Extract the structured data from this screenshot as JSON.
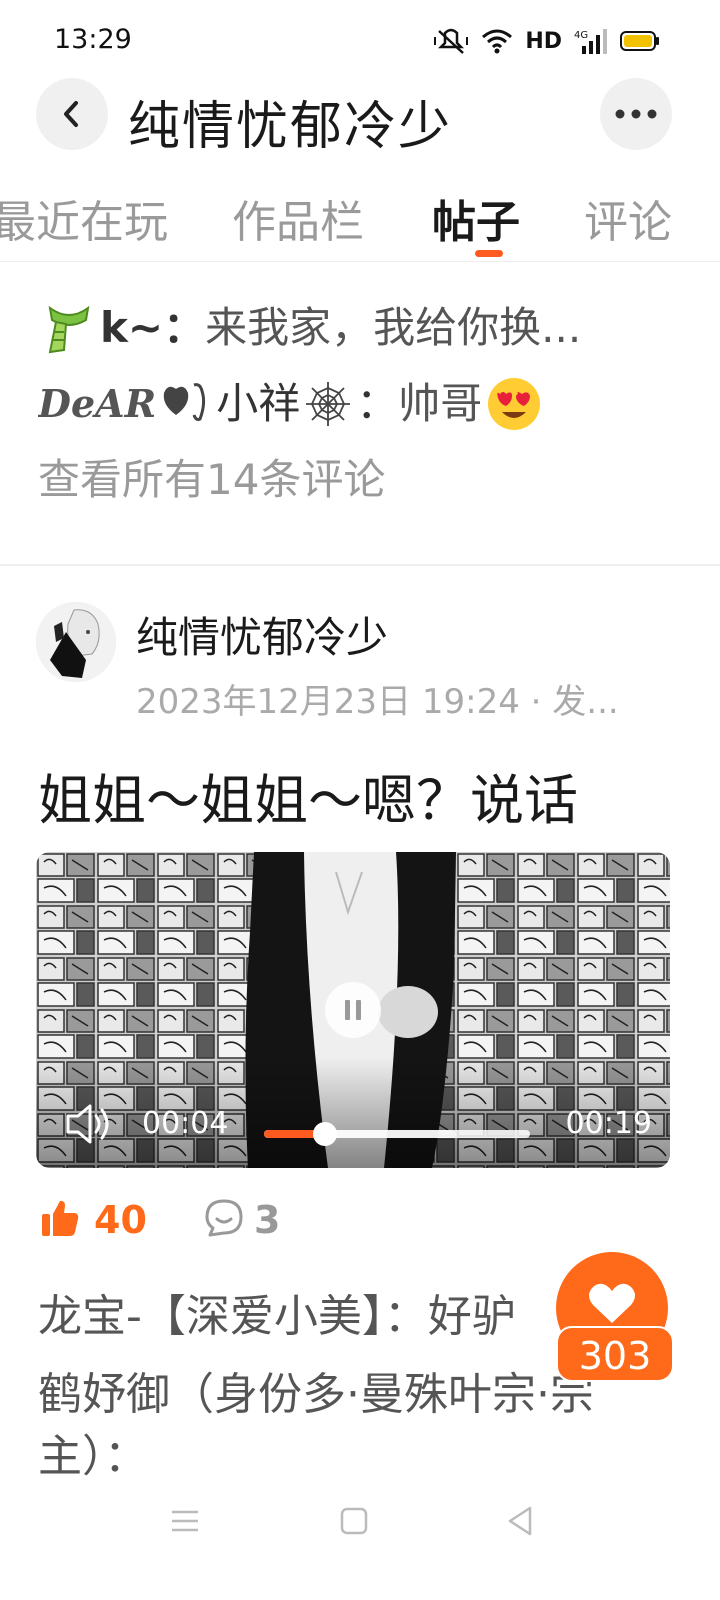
{
  "status_bar": {
    "time": "13:29",
    "network": "HD",
    "signal": "4G"
  },
  "header": {
    "title": "纯情忧郁冷少"
  },
  "tabs": [
    {
      "label": "最近在玩"
    },
    {
      "label": "作品栏"
    },
    {
      "label": "帖子"
    },
    {
      "label": "评论"
    }
  ],
  "active_tab": "帖子",
  "comments_preview": {
    "items": [
      {
        "author": "k~",
        "separator": "：",
        "text": "来我家，我给你换..."
      },
      {
        "author_prefix": "DeAR",
        "author": "小祥",
        "separator": "：",
        "text": "帅哥"
      }
    ],
    "view_all": "查看所有14条评论"
  },
  "post": {
    "author": "纯情忧郁冷少",
    "time": "2023年12月23日 19:24 · 发...",
    "title": "姐姐～姐姐～嗯？说话",
    "video": {
      "current": "00:04",
      "total": "00:19",
      "progress": 0.23,
      "buffered": 0.72
    },
    "likes": "40",
    "comments": "3"
  },
  "bottom_comments": [
    {
      "text": "龙宝-【深爱小美】：好驴"
    },
    {
      "text": "鹤妤御（身份多·曼殊叶宗·宗"
    },
    {
      "text": "主）："
    }
  ],
  "float_like": {
    "count": "303"
  },
  "colors": {
    "accent": "#ff6a1a",
    "underline": "#ff5a1f",
    "muted": "#9a9a9a"
  }
}
